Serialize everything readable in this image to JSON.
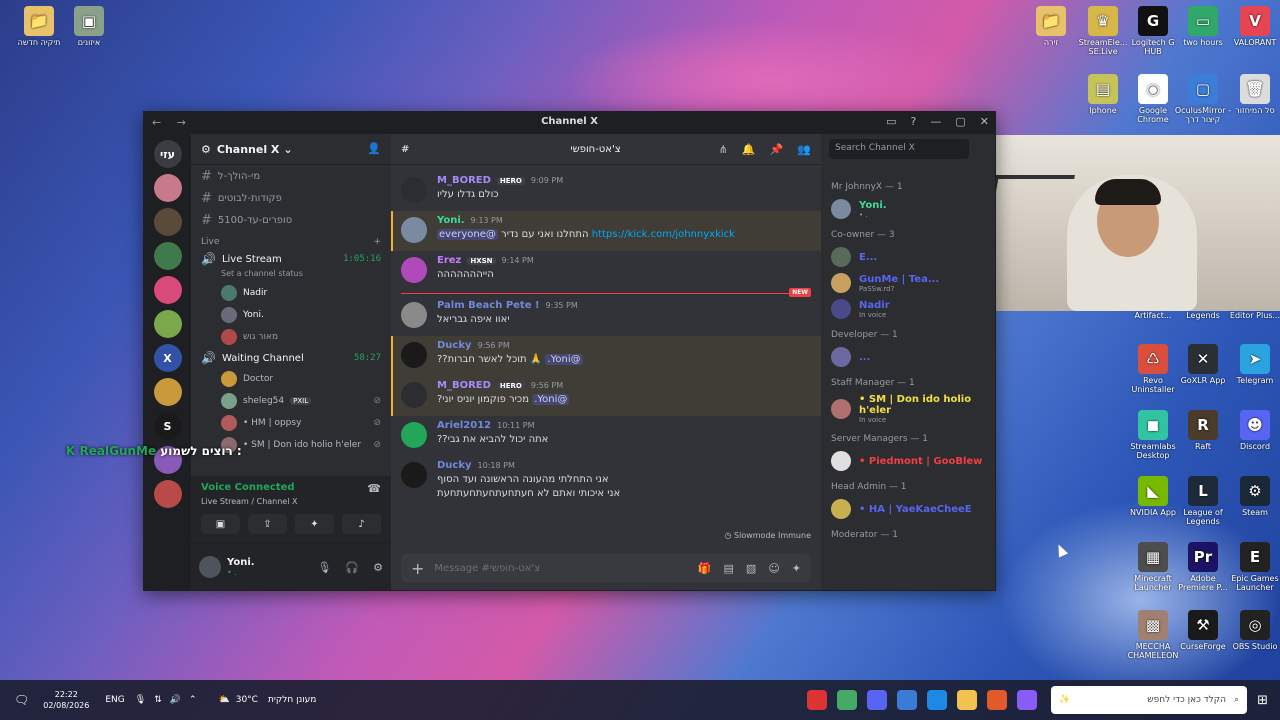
{
  "desktop": {
    "icons": [
      {
        "label": "תיקיה חדשה",
        "glyph": "📁",
        "color": "#e8c26a"
      },
      {
        "label": "איזונים",
        "glyph": "▣",
        "color": "#8aa08a"
      },
      {
        "label": "זירה",
        "glyph": "📁",
        "color": "#e8c26a"
      },
      {
        "label": "StreamEle... SE.Live",
        "glyph": "♛",
        "color": "#d7b64a"
      },
      {
        "label": "Logitech G HUB",
        "glyph": "G",
        "color": "#111111"
      },
      {
        "label": "two hours",
        "glyph": "▭",
        "color": "#2fa86a"
      },
      {
        "label": "VALORANT",
        "glyph": "V",
        "color": "#e64553"
      },
      {
        "label": "Iphone",
        "glyph": "▤",
        "color": "#c7c35b"
      },
      {
        "label": "Google Chrome",
        "glyph": "◉",
        "color": "#ffffff"
      },
      {
        "label": "OculusMirror - קיצור דרך",
        "glyph": "▢",
        "color": "#3b7dd8"
      },
      {
        "label": "סל המיחזור",
        "glyph": "🗑",
        "color": "#dcdcdc"
      },
      {
        "label": "HeliHades Artifact...",
        "glyph": "",
        "color": "transparent"
      },
      {
        "label": "Raid Shadow Legends",
        "glyph": "",
        "color": "transparent"
      },
      {
        "label": "Movavi Video Editor Plus...",
        "glyph": "",
        "color": "transparent"
      },
      {
        "label": "Revo Uninstaller",
        "glyph": "♺",
        "color": "#d94f3c"
      },
      {
        "label": "GoXLR App",
        "glyph": "✕",
        "color": "#2a2f36"
      },
      {
        "label": "Telegram",
        "glyph": "➤",
        "color": "#2aa3e0"
      },
      {
        "label": "Streamlabs Desktop",
        "glyph": "◼",
        "color": "#31c3a2"
      },
      {
        "label": "Raft",
        "glyph": "R",
        "color": "#4a3b2a"
      },
      {
        "label": "Discord",
        "glyph": "☻",
        "color": "#5865f2"
      },
      {
        "label": "NVIDIA App",
        "glyph": "◣",
        "color": "#76b900"
      },
      {
        "label": "League of Legends",
        "glyph": "L",
        "color": "#1d2a3a"
      },
      {
        "label": "Steam",
        "glyph": "⚙",
        "color": "#1b2838"
      },
      {
        "label": "Minecraft Launcher",
        "glyph": "▦",
        "color": "#4d4d4d"
      },
      {
        "label": "Adobe Premiere P...",
        "glyph": "Pr",
        "color": "#1b1464"
      },
      {
        "label": "Epic Games Launcher",
        "glyph": "E",
        "color": "#222222"
      },
      {
        "label": "MECCHA CHAMELEON",
        "glyph": "▩",
        "color": "#a08070"
      },
      {
        "label": "CurseForge",
        "glyph": "⚒",
        "color": "#1a1a1a"
      },
      {
        "label": "OBS Studio",
        "glyph": "◎",
        "color": "#222222"
      }
    ]
  },
  "window": {
    "title": "Channel X",
    "nav": "← →",
    "controls": [
      "▭",
      "?",
      "—",
      "▢",
      "✕"
    ]
  },
  "guilds": [
    {
      "label": "עזי",
      "color": "#3a3c42"
    },
    {
      "label": "",
      "color": "#c77a8a"
    },
    {
      "label": "",
      "color": "#5a4a3a"
    },
    {
      "label": "",
      "color": "#3f7a4a"
    },
    {
      "label": "",
      "color": "#d84a7a"
    },
    {
      "label": "",
      "color": "#7aa84a"
    },
    {
      "label": "X",
      "color": "#3451a8"
    },
    {
      "label": "",
      "color": "#c89a3a"
    },
    {
      "label": "S",
      "color": "#1a1a1a"
    },
    {
      "label": "",
      "color": "#8a5ab8"
    },
    {
      "label": "",
      "color": "#b84a4a"
    }
  ],
  "sidebar": {
    "server_name": "Channel X",
    "channels": [
      {
        "name": "מי-הולך-ל"
      },
      {
        "name": "פקודות-לבוטים"
      },
      {
        "name": "סופרים-עד-5100"
      }
    ],
    "live_category": "Live",
    "voice": [
      {
        "name": "Live Stream",
        "time": "1:05:16",
        "status": "Set a channel status",
        "users": [
          {
            "name": "Nadir",
            "color": "#f2f3f5"
          },
          {
            "name": "Yoni.",
            "color": "#f2f3f5"
          },
          {
            "name": "מאור גוש",
            "color": "#949ba4"
          }
        ]
      },
      {
        "name": "Waiting Channel",
        "time": "58:27",
        "status": "",
        "users": [
          {
            "name": "Doctor",
            "color": "#b5bac1"
          },
          {
            "name": "sheleg54",
            "color": "#b5bac1",
            "tag": "PXIL"
          },
          {
            "name": "• HM | oppsy",
            "color": "#b5bac1"
          },
          {
            "name": "• SM | Don ido holio h'eler",
            "color": "#b5bac1"
          }
        ]
      }
    ],
    "voice_connected": "Voice Connected",
    "voice_sub": "Live Stream / Channel X",
    "user": {
      "name": "Yoni.",
      "status": "• ."
    }
  },
  "chat": {
    "channel_name": "צ'אט-חופשי",
    "messages": [
      {
        "author": "M_BORED",
        "color": "#a78bfa",
        "tag": "HERO",
        "ts": "9:09 PM",
        "text": "כולם גדלו עליו",
        "hl": false,
        "avatar": "#2b2d31"
      },
      {
        "author": "Yoni.",
        "color": "#3ddc97",
        "tag": "",
        "ts": "9:13 PM",
        "link": "https://kick.com/johnnyxkick",
        "text": " התחלנו ואני עם נדיר ",
        "mention": "@everyone",
        "hl": true,
        "avatar": "#7a8aa0"
      },
      {
        "author": "Erez",
        "color": "#c27cff",
        "tag": "HXSN",
        "ts": "9:14 PM",
        "text": "הייההההההה",
        "hl": false,
        "avatar": "#b04ab8"
      },
      {
        "author": "Palm Beach Pete !",
        "color": "#7289da",
        "tag": "",
        "ts": "9:35 PM",
        "text": "יאוו איפה גבריאל",
        "hl": false,
        "avatar": "#8a8a8a"
      },
      {
        "author": "Ducky",
        "color": "#7289da",
        "tag": "",
        "ts": "9:56 PM",
        "text": "🙏 תוכל לאשר חברות??",
        "mention": "@Yoni.",
        "hl": true,
        "avatar": "#1a1a1a"
      },
      {
        "author": "M_BORED",
        "color": "#a78bfa",
        "tag": "HERO",
        "ts": "9:56 PM",
        "text": "מכיר פוקמון יוניס יוני? ",
        "mention": "@Yoni.",
        "hl": true,
        "avatar": "#2b2d31"
      },
      {
        "author": "Ariel2012",
        "color": "#7289da",
        "tag": "",
        "ts": "10:11 PM",
        "text": "אתה יכול להביא את גבי??",
        "hl": false,
        "avatar": "#23a55a"
      },
      {
        "author": "Ducky",
        "color": "#7289da",
        "tag": "",
        "ts": "10:18 PM",
        "text": "אני התחלתי מהעונה הראשונה ועד הסוף",
        "text2": "אני איכותי ואתם לא חעתחעתחעתחעתחעת",
        "hl": false,
        "avatar": "#1a1a1a"
      }
    ],
    "new_label": "NEW",
    "slowmode": "Slowmode Immune",
    "composer_placeholder": "Message #צ'אט-חופשי"
  },
  "members": {
    "search_placeholder": "Search Channel X",
    "groups": [
      {
        "title": "Mr JohnnyX — 1",
        "members": [
          {
            "name": "Yoni.",
            "color": "#3ddc97",
            "sub": "• ."
          }
        ]
      },
      {
        "title": "Co-owner — 3",
        "members": [
          {
            "name": "E...",
            "color": "#5865f2",
            "sub": ""
          },
          {
            "name": "GunMe | Tea...",
            "color": "#5865f2",
            "sub": "PaSSw.rd?"
          },
          {
            "name": "Nadir",
            "color": "#5865f2",
            "sub": "In voice"
          }
        ]
      },
      {
        "title": "Developer — 1",
        "members": [
          {
            "name": "...",
            "color": "#5865f2",
            "sub": ""
          }
        ]
      },
      {
        "title": "Staff Manager — 1",
        "members": [
          {
            "name": "• SM | Don ido holio h'eler",
            "color": "#f0e040",
            "sub": "In voice"
          }
        ]
      },
      {
        "title": "Server Managers — 1",
        "members": [
          {
            "name": "• Piedmont | GooBlew",
            "color": "#f23f43",
            "sub": ""
          }
        ]
      },
      {
        "title": "Head Admin — 1",
        "members": [
          {
            "name": "• HA | YaeKaeCheeE",
            "color": "#5865f2",
            "sub": ""
          }
        ]
      },
      {
        "title": "Moderator — 1",
        "members": []
      }
    ]
  },
  "overlay": {
    "name": "RealGunMe",
    "text": "רוצים לשמוע :"
  },
  "taskbar": {
    "time": "22:22",
    "date": "02/08/2026",
    "lang": "ENG",
    "weather": "30°C",
    "weather_text": "מעונן חלקית",
    "search_placeholder": "הקלד כאן כדי לחפש"
  }
}
